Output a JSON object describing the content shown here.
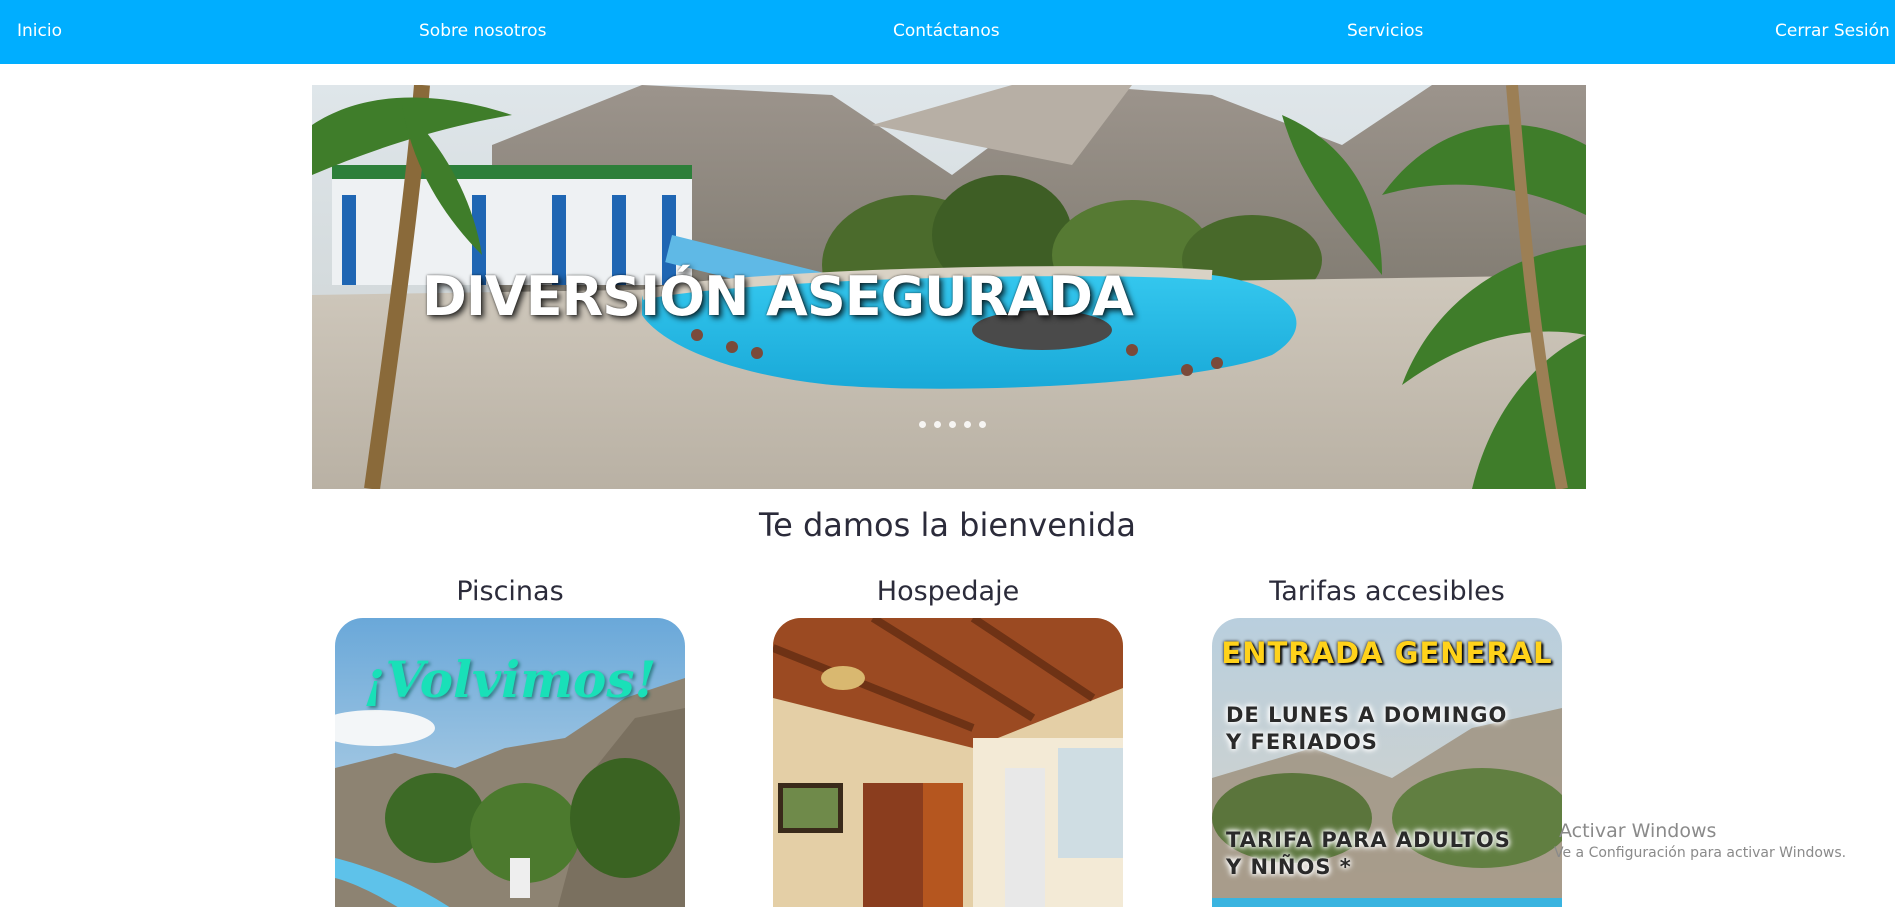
{
  "nav": {
    "inicio": "Inicio",
    "sobre": "Sobre nosotros",
    "contacto": "Contáctanos",
    "servicios": "Servicios",
    "cerrar": "Cerrar Sesión"
  },
  "hero": {
    "caption": "DIVERSIÓN ASEGURADA",
    "slide_count": 5
  },
  "welcome": "Te damos la bienvenida",
  "cards": [
    {
      "title": "Piscinas",
      "image_text": "¡Volvimos!"
    },
    {
      "title": "Hospedaje"
    },
    {
      "title": "Tarifas accesibles",
      "image_header": "ENTRADA GENERAL",
      "line1a": "DE LUNES A DOMINGO",
      "line1b": "Y FERIADOS",
      "line2a": "TARIFA PARA ADULTOS",
      "line2b": "Y NIÑOS *"
    }
  ],
  "watermark": {
    "title": "Activar Windows",
    "subtitle": "Ve a Configuración para activar Windows."
  },
  "colors": {
    "nav_bg": "#00aeff",
    "nav_text": "#ffffff",
    "heading": "#2b2b3a",
    "pool": "#2fc2e8"
  }
}
